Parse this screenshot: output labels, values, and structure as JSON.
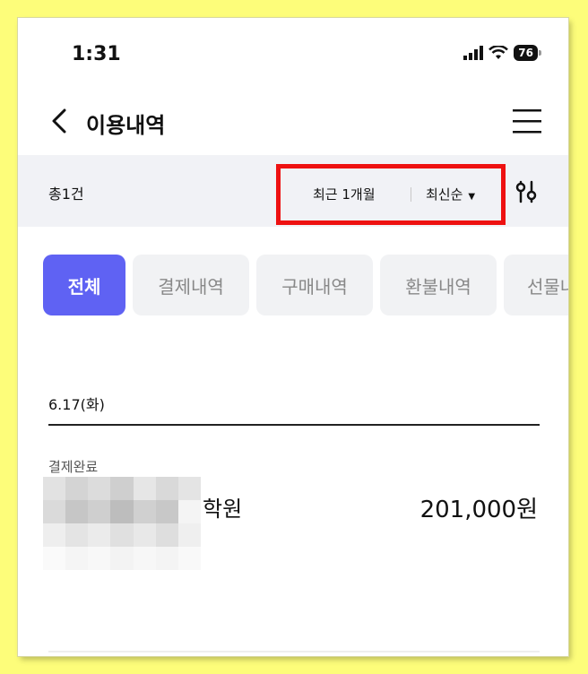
{
  "status_bar": {
    "time": "1:31",
    "battery": "76"
  },
  "header": {
    "title": "이용내역"
  },
  "filter": {
    "total_count": "총1건",
    "period": "최근 1개월",
    "sort": "최신순"
  },
  "tabs": [
    {
      "label": "전체",
      "active": true
    },
    {
      "label": "결제내역",
      "active": false
    },
    {
      "label": "구매내역",
      "active": false
    },
    {
      "label": "환불내역",
      "active": false
    },
    {
      "label": "선물내역",
      "active": false
    }
  ],
  "transactions": [
    {
      "date": "6.17(화)",
      "status": "결제완료",
      "merchant": "학원",
      "amount": "201,000원"
    }
  ],
  "colors": {
    "accent": "#5f62f3",
    "highlight_box": "#ee1111",
    "page_background": "#fdfd7a"
  }
}
